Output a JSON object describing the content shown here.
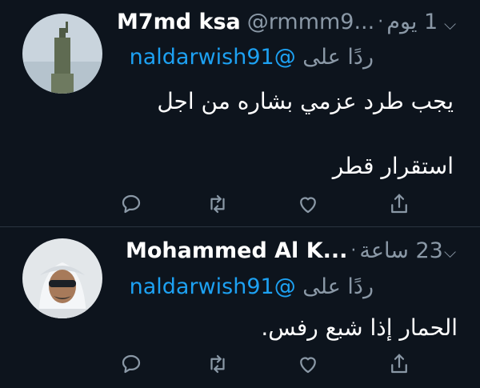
{
  "tweets": [
    {
      "name": "M7md ksa",
      "handle": "@rmmm9...",
      "separator": "·",
      "time": "1 يوم",
      "reply_label": "ردًا على",
      "reply_to": "@naldarwish91",
      "lines": [
        "يجب  طرد عزمي بشاره من اجل",
        "استقرار قطر"
      ]
    },
    {
      "name": "Mohammed Al K...",
      "handle": "",
      "separator": "·",
      "time": "23 ساعة",
      "reply_label": "ردًا على",
      "reply_to": "@naldarwish91",
      "lines": [
        "الحمار إذا شبع رفس."
      ]
    }
  ],
  "icons": {
    "reply": "reply-icon",
    "retweet": "retweet-icon",
    "like": "like-icon",
    "share": "share-icon",
    "menu": "chevron-down-icon"
  },
  "colors": {
    "background": "#0d141d",
    "text": "#ffffff",
    "muted": "#8a98a6",
    "link": "#1da1f2"
  }
}
